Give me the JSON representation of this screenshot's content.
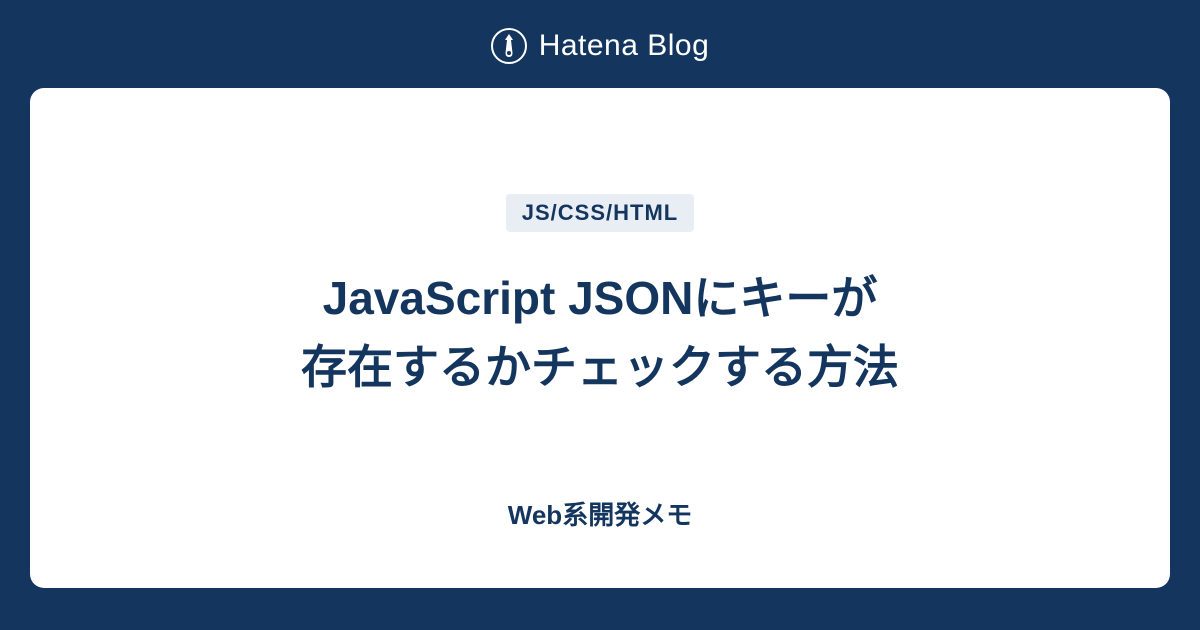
{
  "header": {
    "brand": "Hatena Blog"
  },
  "card": {
    "category": "JS/CSS/HTML",
    "title": "JavaScript JSONにキーが\n存在するかチェックする方法",
    "blog_name": "Web系開発メモ"
  }
}
